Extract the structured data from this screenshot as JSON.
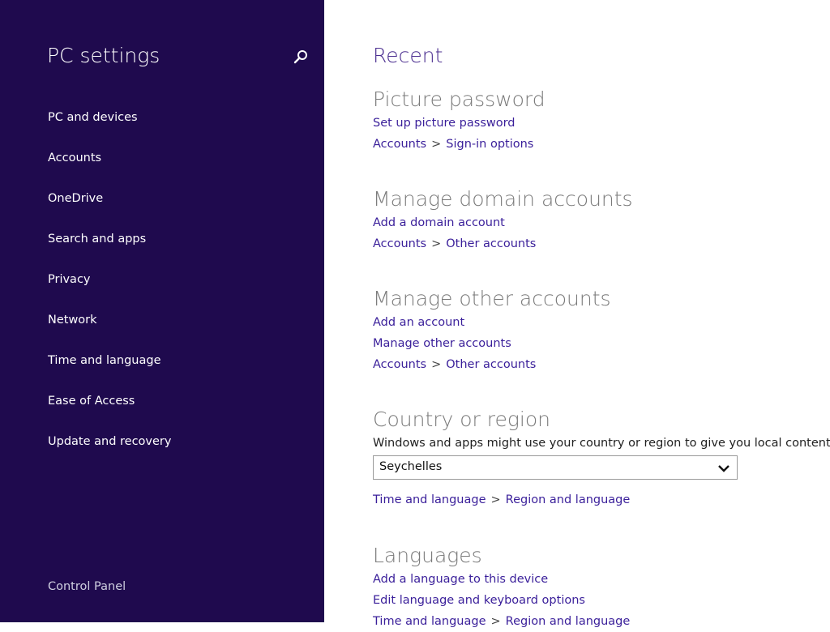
{
  "sidebar": {
    "title": "PC settings",
    "search_icon": "search-icon",
    "items": [
      {
        "label": "PC and devices"
      },
      {
        "label": "Accounts"
      },
      {
        "label": "OneDrive"
      },
      {
        "label": "Search and apps"
      },
      {
        "label": "Privacy"
      },
      {
        "label": "Network"
      },
      {
        "label": "Time and language"
      },
      {
        "label": "Ease of Access"
      },
      {
        "label": "Update and recovery"
      }
    ],
    "footer_link": "Control Panel",
    "background": "#1f0a4e"
  },
  "main": {
    "title": "Recent",
    "sections": [
      {
        "heading": "Picture password",
        "links": [
          "Set up picture password"
        ],
        "crumb": [
          "Accounts",
          ">",
          "Sign-in options"
        ]
      },
      {
        "heading": "Manage domain accounts",
        "links": [
          "Add a domain account"
        ],
        "crumb": [
          "Accounts",
          ">",
          "Other accounts"
        ]
      },
      {
        "heading": "Manage other accounts",
        "links": [
          "Add an account",
          "Manage other accounts"
        ],
        "crumb": [
          "Accounts",
          ">",
          "Other accounts"
        ]
      },
      {
        "heading": "Country or region",
        "description": "Windows and apps might use your country or region to give you local content",
        "select_value": "Seychelles",
        "crumb": [
          "Time and language",
          ">",
          "Region and language"
        ]
      },
      {
        "heading": "Languages",
        "links": [
          "Add a language to this device",
          "Edit language and keyboard options"
        ],
        "crumb": [
          "Time and language",
          ">",
          "Region and language"
        ]
      }
    ],
    "link_color": "#3a1f9a",
    "heading_color": "#7a7a7a",
    "title_color": "#4a2d8f"
  }
}
